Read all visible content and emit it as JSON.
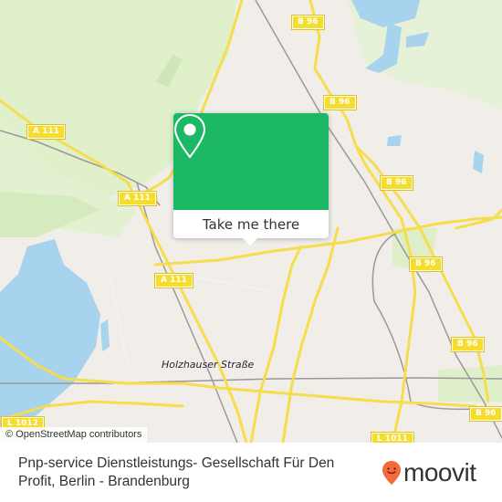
{
  "map": {
    "road_shields": [
      {
        "id": "a111-1",
        "label": "A 111"
      },
      {
        "id": "a111-2",
        "label": "A 111"
      },
      {
        "id": "a111-3",
        "label": "A 111"
      },
      {
        "id": "b96-1",
        "label": "B 96"
      },
      {
        "id": "b96-2",
        "label": "B 96"
      },
      {
        "id": "b96-3",
        "label": "B 96"
      },
      {
        "id": "b96-4",
        "label": "B 96"
      },
      {
        "id": "b96-5",
        "label": "B 96"
      },
      {
        "id": "b96-6",
        "label": "B 96"
      },
      {
        "id": "l1012",
        "label": "L 1012"
      },
      {
        "id": "l1011",
        "label": "L 1011"
      }
    ],
    "place_labels": [
      "Holzhauser Straße"
    ],
    "attribution": "© OpenStreetMap contributors",
    "colors": {
      "land": "#f1eeea",
      "forest": "#e0f0cb",
      "water": "#a7d3ee",
      "road": "#f6dd4c",
      "rail": "#999999"
    }
  },
  "popup": {
    "icon": "location-pin-icon",
    "button_label": "Take me there",
    "accent_color": "#1db866"
  },
  "footer": {
    "title": "Pnp-service Dienstleistungs- Gesellschaft Für Den Profit, Berlin - Brandenburg",
    "brand": "moovit",
    "brand_color": "#f26a3d"
  }
}
